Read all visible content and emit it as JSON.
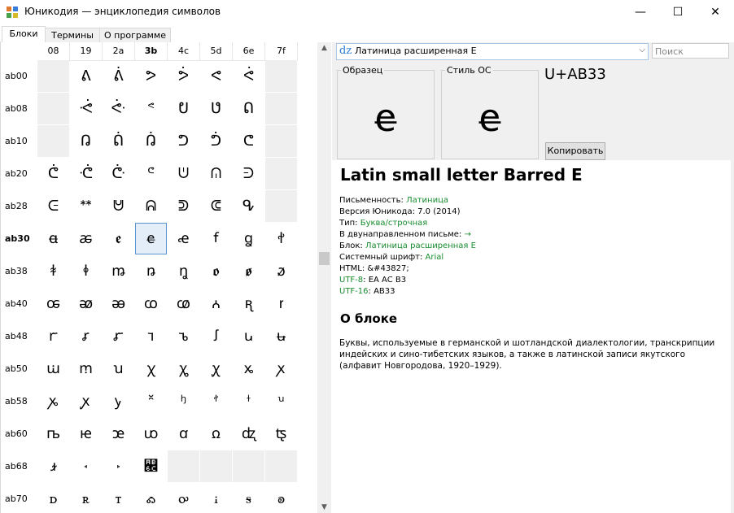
{
  "window": {
    "title": "Юникодия — энциклопедия символов",
    "minimize": "—",
    "maximize": "☐",
    "close": "✕"
  },
  "tabs": [
    {
      "label": "Блоки"
    },
    {
      "label": "Термины"
    },
    {
      "label": "О программе"
    }
  ],
  "grid": {
    "columns": [
      "08",
      "19",
      "2a",
      "3b",
      "4c",
      "5d",
      "6e",
      "7f"
    ],
    "selected_column": "3b",
    "rows": [
      {
        "label": "ab00",
        "cells": [
          "",
          "ᕕ",
          "ᕖ",
          "ᕗ",
          "ᕘ",
          "ᕙ",
          "ᕚ",
          ""
        ]
      },
      {
        "label": "ab08",
        "cells": [
          "",
          "ᕛ",
          "ᕜ",
          "ᕝ",
          "ᕞ",
          "ᕟ",
          "ᕠ",
          ""
        ]
      },
      {
        "label": "ab10",
        "cells": [
          "",
          "ᕡ",
          "ᕢ",
          "ᕣ",
          "ᕤ",
          "ᕥ",
          "ᕦ",
          ""
        ]
      },
      {
        "label": "ab20",
        "cells": [
          "ᕧ",
          "ᕨ",
          "ᕩ",
          "ᕪ",
          "ᕫ",
          "ᕬ",
          "ᕭ",
          ""
        ]
      },
      {
        "label": "ab28",
        "cells": [
          "ᕮ",
          "ᕯ",
          "ᕰ",
          "ᕱ",
          "ᕲ",
          "ᕳ",
          "ᕴ",
          ""
        ]
      },
      {
        "label": "ab30",
        "cells": [
          "ꬰ",
          "ꬱ",
          "ꬲ",
          "ꬳ",
          "ꬴ",
          "ꬵ",
          "ꬶ",
          "ꬷ"
        ]
      },
      {
        "label": "ab38",
        "cells": [
          "ꬸ",
          "ꬹ",
          "ꬺ",
          "ꬻ",
          "ꬼ",
          "ꬽ",
          "ꬾ",
          "ꬿ"
        ]
      },
      {
        "label": "ab40",
        "cells": [
          "ꭀ",
          "ꭁ",
          "ꭂ",
          "ꭃ",
          "ꭄ",
          "ꭅ",
          "ꭆ",
          "ꭇ"
        ]
      },
      {
        "label": "ab48",
        "cells": [
          "ꭈ",
          "ꭉ",
          "ꭊ",
          "ꭋ",
          "ꭌ",
          "ꭍ",
          "ꭎ",
          "ꭏ"
        ]
      },
      {
        "label": "ab50",
        "cells": [
          "ꭐ",
          "ꭑ",
          "ꭒ",
          "ꭓ",
          "ꭔ",
          "ꭕ",
          "ꭖ",
          "ꭗ"
        ]
      },
      {
        "label": "ab58",
        "cells": [
          "ꭘ",
          "ꭙ",
          "ꭚ",
          "꭛",
          "ꭜ",
          "ꭝ",
          "ꭞ",
          "ꭟ"
        ]
      },
      {
        "label": "ab60",
        "cells": [
          "ꭠ",
          "ꭡ",
          "ꭢ",
          "ꭣ",
          "ꭤ",
          "ꭥ",
          "ꭦ",
          "ꭧ"
        ]
      },
      {
        "label": "ab68",
        "cells": [
          "ꭨ",
          "꭪",
          "꭫",
          "꭬",
          "",
          "",
          "",
          ""
        ]
      },
      {
        "label": "ab70",
        "cells": [
          "ꭰ",
          "ꭱ",
          "ꭲ",
          "ꭳ",
          "ꭴ",
          "ꭵ",
          "ꭶ",
          "ꭷ"
        ]
      }
    ],
    "selected_row": "ab30"
  },
  "block_combo": {
    "icon": "dz",
    "text": "Латиница расширенная E"
  },
  "search": {
    "placeholder": "Поиск"
  },
  "sample": {
    "label": "Образец",
    "glyph": "ꬳ"
  },
  "os_style": {
    "label": "Стиль ОС",
    "glyph": "ꬳ"
  },
  "codepoint": "U+AB33",
  "copy_button": "Копировать",
  "info": {
    "name": "Latin small letter Barred E",
    "props": [
      {
        "key": "Письменность: ",
        "value": "Латиница",
        "link": true
      },
      {
        "key": "Версия Юникода: ",
        "value": "7.0 (2014)",
        "link": false
      },
      {
        "key": "Тип: ",
        "value": "Буква/строчная",
        "link": true
      },
      {
        "key": "В двунаправленном письме: ",
        "value": "→",
        "link": true
      },
      {
        "key": "Блок: ",
        "value": "Латиница расширенная E",
        "link": true
      },
      {
        "key": "Системный шрифт: ",
        "value": "Arial",
        "link": true
      },
      {
        "key": "HTML: ",
        "value": "&#43827;",
        "link": false
      },
      {
        "key": "UTF-8",
        "value": ": EA AC B3",
        "keylink": true
      },
      {
        "key": "UTF-16",
        "value": ": AB33",
        "keylink": true
      }
    ],
    "block_heading": "О блоке",
    "block_description": "Буквы, используемые в германской и шотландской диалектологии, транскрипции индейских и сино-тибетских языков, а также в латинской записи якутского (алфавит Новгородова, 1920–1929)."
  }
}
